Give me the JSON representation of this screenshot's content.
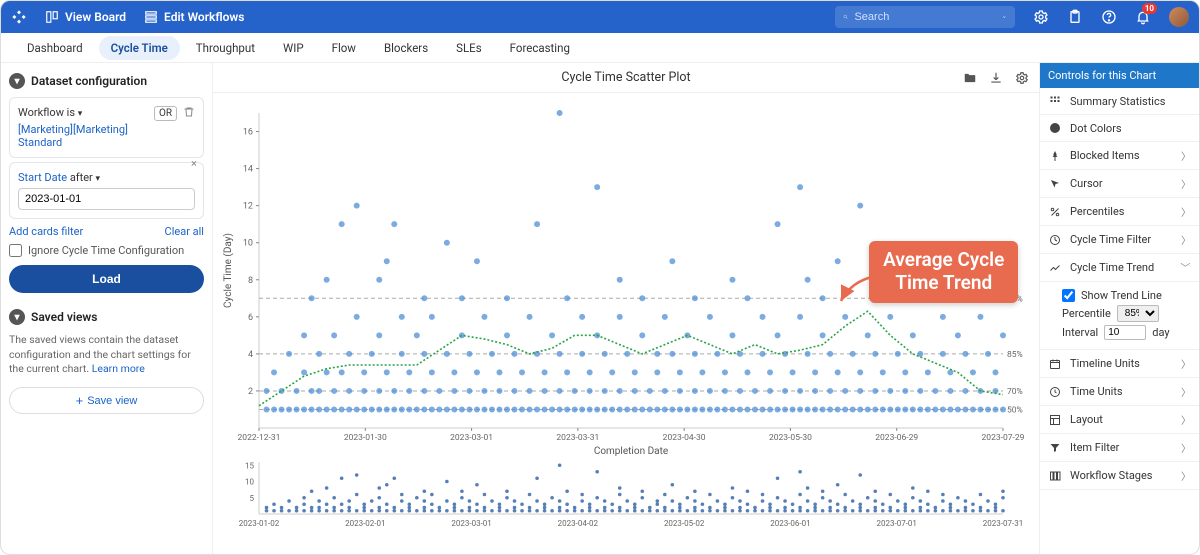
{
  "topbar": {
    "view_board": "View Board",
    "edit_workflows": "Edit Workflows",
    "search_placeholder": "Search",
    "notif_count": "10"
  },
  "tabs": [
    "Dashboard",
    "Cycle Time",
    "Throughput",
    "WIP",
    "Flow",
    "Blockers",
    "SLEs",
    "Forecasting"
  ],
  "active_tab_index": 1,
  "left": {
    "dataset_hdr": "Dataset configuration",
    "workflow_label": "Workflow is",
    "workflow_value": "[Marketing][Marketing] Standard",
    "or_label": "OR",
    "startdate_label": "Start Date",
    "after_label": "after",
    "startdate_value": "2023-01-01",
    "add_filter": "Add cards filter",
    "clear_all": "Clear all",
    "ignore_label": "Ignore Cycle Time Configuration",
    "load_btn": "Load",
    "saved_hdr": "Saved views",
    "saved_text": "The saved views contain the dataset configuration and the chart settings for the current chart. ",
    "learn_more": "Learn more",
    "save_view": "Save view"
  },
  "chart": {
    "title": "Cycle Time Scatter Plot",
    "ylabel": "Cycle Time (Day)",
    "xlabel": "Completion Date",
    "callout": "Average Cycle\nTime Trend"
  },
  "right": {
    "header": "Controls for this Chart",
    "items": [
      {
        "icon": "grid",
        "label": "Summary Statistics",
        "chev": false
      },
      {
        "icon": "dot",
        "label": "Dot Colors",
        "chev": false
      },
      {
        "icon": "pin",
        "label": "Blocked Items",
        "chev": true
      },
      {
        "icon": "cursor",
        "label": "Cursor",
        "chev": true
      },
      {
        "icon": "percent",
        "label": "Percentiles",
        "chev": true
      },
      {
        "icon": "filter",
        "label": "Cycle Time Filter",
        "chev": true
      },
      {
        "icon": "trend",
        "label": "Cycle Time Trend",
        "chev": true,
        "expanded": true
      },
      {
        "icon": "cal",
        "label": "Timeline Units",
        "chev": true
      },
      {
        "icon": "clock",
        "label": "Time Units",
        "chev": true
      },
      {
        "icon": "layout",
        "label": "Layout",
        "chev": true
      },
      {
        "icon": "funnel",
        "label": "Item Filter",
        "chev": true
      },
      {
        "icon": "stages",
        "label": "Workflow Stages",
        "chev": true
      }
    ],
    "trend_sub": {
      "show_trend": "Show Trend Line",
      "percentile_label": "Percentile",
      "percentile_value": "85%",
      "interval_label": "Interval",
      "interval_value": "10",
      "interval_unit": "day"
    }
  },
  "chart_data": {
    "type": "scatter",
    "title": "Cycle Time Scatter Plot",
    "xlabel": "Completion Date",
    "ylabel": "Cycle Time (Day)",
    "ylim": [
      0,
      17
    ],
    "y_ticks": [
      2,
      4,
      6,
      8,
      10,
      12,
      14,
      16
    ],
    "x_ticks": [
      "2022-12-31",
      "2023-01-30",
      "2023-03-01",
      "2023-03-31",
      "2023-04-30",
      "2023-05-30",
      "2023-06-29",
      "2023-07-29"
    ],
    "percentile_lines": [
      {
        "label": "95%",
        "value": 7
      },
      {
        "label": "85%",
        "value": 4
      },
      {
        "label": "70%",
        "value": 2
      },
      {
        "label": "50%",
        "value": 1
      }
    ],
    "trend_series": {
      "name": "Average Cycle Time Trend",
      "x_index": [
        0,
        3,
        6,
        9,
        12,
        15,
        18,
        21,
        24,
        27,
        30,
        33,
        36,
        39,
        42,
        45,
        48,
        51,
        54,
        57,
        60,
        63,
        66,
        69,
        72,
        75,
        78,
        81,
        84,
        87,
        90,
        93,
        96,
        99
      ],
      "y": [
        1.2,
        2.0,
        2.8,
        3.2,
        3.4,
        3.4,
        3.4,
        3.4,
        4.2,
        5.0,
        4.8,
        4.5,
        4.0,
        4.3,
        5.0,
        5.0,
        4.5,
        4.0,
        4.5,
        5.0,
        4.5,
        4.0,
        4.5,
        4.0,
        4.2,
        4.5,
        5.5,
        6.3,
        5.0,
        4.0,
        3.5,
        3.0,
        2.0,
        1.8
      ]
    },
    "scatter_points_xi_y": [
      [
        1,
        1
      ],
      [
        1,
        2
      ],
      [
        2,
        1
      ],
      [
        2,
        3
      ],
      [
        3,
        1
      ],
      [
        3,
        2
      ],
      [
        4,
        1
      ],
      [
        4,
        4
      ],
      [
        5,
        1
      ],
      [
        5,
        2
      ],
      [
        6,
        1
      ],
      [
        6,
        3
      ],
      [
        6,
        5
      ],
      [
        7,
        1
      ],
      [
        7,
        2
      ],
      [
        7,
        7
      ],
      [
        8,
        1
      ],
      [
        8,
        2
      ],
      [
        8,
        4
      ],
      [
        9,
        1
      ],
      [
        9,
        3
      ],
      [
        9,
        8
      ],
      [
        10,
        1
      ],
      [
        10,
        2
      ],
      [
        10,
        5
      ],
      [
        11,
        1
      ],
      [
        11,
        11
      ],
      [
        11,
        3
      ],
      [
        12,
        1
      ],
      [
        12,
        2
      ],
      [
        12,
        4
      ],
      [
        13,
        1
      ],
      [
        13,
        6
      ],
      [
        13,
        12
      ],
      [
        14,
        1
      ],
      [
        14,
        2
      ],
      [
        14,
        3
      ],
      [
        15,
        1
      ],
      [
        15,
        4
      ],
      [
        16,
        1
      ],
      [
        16,
        2
      ],
      [
        16,
        5
      ],
      [
        16,
        8
      ],
      [
        17,
        1
      ],
      [
        17,
        3
      ],
      [
        17,
        9
      ],
      [
        18,
        1
      ],
      [
        18,
        2
      ],
      [
        18,
        11
      ],
      [
        19,
        1
      ],
      [
        19,
        4
      ],
      [
        19,
        6
      ],
      [
        20,
        1
      ],
      [
        20,
        2
      ],
      [
        20,
        3
      ],
      [
        21,
        1
      ],
      [
        21,
        5
      ],
      [
        22,
        1
      ],
      [
        22,
        2
      ],
      [
        22,
        4
      ],
      [
        22,
        7
      ],
      [
        23,
        1
      ],
      [
        23,
        3
      ],
      [
        23,
        6
      ],
      [
        24,
        1
      ],
      [
        24,
        2
      ],
      [
        25,
        1
      ],
      [
        25,
        4
      ],
      [
        25,
        10
      ],
      [
        26,
        1
      ],
      [
        26,
        2
      ],
      [
        26,
        3
      ],
      [
        27,
        1
      ],
      [
        27,
        5
      ],
      [
        27,
        7
      ],
      [
        28,
        1
      ],
      [
        28,
        2
      ],
      [
        28,
        4
      ],
      [
        29,
        1
      ],
      [
        29,
        3
      ],
      [
        29,
        9
      ],
      [
        30,
        1
      ],
      [
        30,
        2
      ],
      [
        30,
        6
      ],
      [
        31,
        1
      ],
      [
        31,
        4
      ],
      [
        32,
        1
      ],
      [
        32,
        2
      ],
      [
        32,
        3
      ],
      [
        33,
        1
      ],
      [
        33,
        5
      ],
      [
        33,
        7
      ],
      [
        34,
        1
      ],
      [
        34,
        2
      ],
      [
        34,
        4
      ],
      [
        35,
        1
      ],
      [
        35,
        3
      ],
      [
        36,
        1
      ],
      [
        36,
        2
      ],
      [
        36,
        6
      ],
      [
        37,
        1
      ],
      [
        37,
        4
      ],
      [
        37,
        11
      ],
      [
        38,
        1
      ],
      [
        38,
        2
      ],
      [
        38,
        3
      ],
      [
        39,
        1
      ],
      [
        39,
        5
      ],
      [
        40,
        1
      ],
      [
        40,
        2
      ],
      [
        40,
        4
      ],
      [
        40,
        17
      ],
      [
        41,
        1
      ],
      [
        41,
        3
      ],
      [
        41,
        7
      ],
      [
        42,
        1
      ],
      [
        42,
        2
      ],
      [
        43,
        1
      ],
      [
        43,
        4
      ],
      [
        43,
        6
      ],
      [
        44,
        1
      ],
      [
        44,
        2
      ],
      [
        44,
        3
      ],
      [
        45,
        1
      ],
      [
        45,
        5
      ],
      [
        45,
        13
      ],
      [
        46,
        1
      ],
      [
        46,
        2
      ],
      [
        46,
        4
      ],
      [
        47,
        1
      ],
      [
        47,
        3
      ],
      [
        48,
        1
      ],
      [
        48,
        2
      ],
      [
        48,
        6
      ],
      [
        48,
        8
      ],
      [
        49,
        1
      ],
      [
        49,
        4
      ],
      [
        50,
        1
      ],
      [
        50,
        2
      ],
      [
        50,
        3
      ],
      [
        51,
        1
      ],
      [
        51,
        5
      ],
      [
        51,
        7
      ],
      [
        52,
        1
      ],
      [
        52,
        2
      ],
      [
        53,
        1
      ],
      [
        53,
        3
      ],
      [
        53,
        4
      ],
      [
        54,
        1
      ],
      [
        54,
        2
      ],
      [
        54,
        6
      ],
      [
        55,
        1
      ],
      [
        55,
        4
      ],
      [
        55,
        9
      ],
      [
        56,
        1
      ],
      [
        56,
        2
      ],
      [
        56,
        3
      ],
      [
        57,
        1
      ],
      [
        57,
        5
      ],
      [
        58,
        1
      ],
      [
        58,
        2
      ],
      [
        58,
        4
      ],
      [
        58,
        7
      ],
      [
        59,
        1
      ],
      [
        59,
        3
      ],
      [
        60,
        1
      ],
      [
        60,
        2
      ],
      [
        60,
        6
      ],
      [
        61,
        1
      ],
      [
        61,
        4
      ],
      [
        62,
        1
      ],
      [
        62,
        2
      ],
      [
        62,
        3
      ],
      [
        63,
        1
      ],
      [
        63,
        5
      ],
      [
        63,
        8
      ],
      [
        64,
        1
      ],
      [
        64,
        2
      ],
      [
        64,
        4
      ],
      [
        65,
        1
      ],
      [
        65,
        3
      ],
      [
        65,
        7
      ],
      [
        66,
        1
      ],
      [
        66,
        2
      ],
      [
        67,
        1
      ],
      [
        67,
        4
      ],
      [
        67,
        6
      ],
      [
        68,
        1
      ],
      [
        68,
        2
      ],
      [
        68,
        3
      ],
      [
        69,
        1
      ],
      [
        69,
        5
      ],
      [
        69,
        11
      ],
      [
        70,
        1
      ],
      [
        70,
        2
      ],
      [
        70,
        4
      ],
      [
        71,
        1
      ],
      [
        71,
        3
      ],
      [
        72,
        1
      ],
      [
        72,
        2
      ],
      [
        72,
        6
      ],
      [
        72,
        13
      ],
      [
        73,
        1
      ],
      [
        73,
        4
      ],
      [
        73,
        8
      ],
      [
        74,
        1
      ],
      [
        74,
        2
      ],
      [
        74,
        3
      ],
      [
        75,
        1
      ],
      [
        75,
        5
      ],
      [
        75,
        7
      ],
      [
        76,
        1
      ],
      [
        76,
        2
      ],
      [
        76,
        4
      ],
      [
        77,
        1
      ],
      [
        77,
        3
      ],
      [
        77,
        9
      ],
      [
        78,
        1
      ],
      [
        78,
        2
      ],
      [
        78,
        6
      ],
      [
        79,
        1
      ],
      [
        79,
        4
      ],
      [
        80,
        1
      ],
      [
        80,
        2
      ],
      [
        80,
        3
      ],
      [
        80,
        12
      ],
      [
        81,
        1
      ],
      [
        81,
        5
      ],
      [
        82,
        1
      ],
      [
        82,
        2
      ],
      [
        82,
        4
      ],
      [
        82,
        7
      ],
      [
        83,
        1
      ],
      [
        83,
        3
      ],
      [
        84,
        1
      ],
      [
        84,
        2
      ],
      [
        84,
        6
      ],
      [
        85,
        1
      ],
      [
        85,
        4
      ],
      [
        86,
        1
      ],
      [
        86,
        2
      ],
      [
        86,
        3
      ],
      [
        87,
        1
      ],
      [
        87,
        5
      ],
      [
        87,
        8
      ],
      [
        88,
        1
      ],
      [
        88,
        2
      ],
      [
        88,
        4
      ],
      [
        89,
        1
      ],
      [
        89,
        3
      ],
      [
        89,
        7
      ],
      [
        90,
        1
      ],
      [
        90,
        2
      ],
      [
        91,
        1
      ],
      [
        91,
        4
      ],
      [
        91,
        6
      ],
      [
        92,
        1
      ],
      [
        92,
        2
      ],
      [
        92,
        3
      ],
      [
        93,
        1
      ],
      [
        93,
        5
      ],
      [
        94,
        1
      ],
      [
        94,
        2
      ],
      [
        94,
        4
      ],
      [
        95,
        1
      ],
      [
        95,
        3
      ],
      [
        96,
        1
      ],
      [
        96,
        2
      ],
      [
        96,
        6
      ],
      [
        97,
        1
      ],
      [
        97,
        4
      ],
      [
        98,
        1
      ],
      [
        98,
        2
      ],
      [
        98,
        3
      ],
      [
        99,
        1
      ],
      [
        99,
        5
      ],
      [
        99,
        7
      ]
    ],
    "overview": {
      "ylim": [
        0,
        16
      ],
      "y_ticks": [
        5,
        10,
        15
      ],
      "x_ticks": [
        "2023-01-02",
        "2023-02-01",
        "2023-03-01",
        "2023-04-02",
        "2023-05-02",
        "2023-06-01",
        "2023-07-01",
        "2023-07-31"
      ]
    }
  }
}
